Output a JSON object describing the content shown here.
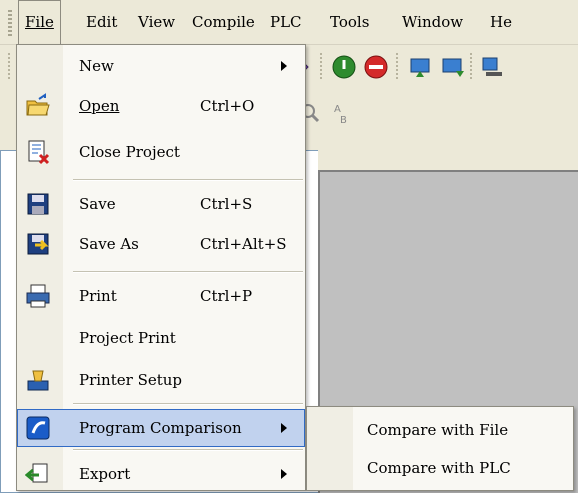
{
  "menubar": {
    "items": [
      {
        "label": "File"
      },
      {
        "label": "Edit"
      },
      {
        "label": "View"
      },
      {
        "label": "Compile"
      },
      {
        "label": "PLC"
      },
      {
        "label": "Tools"
      },
      {
        "label": "Window"
      },
      {
        "label": "He"
      }
    ]
  },
  "file_menu": {
    "items": [
      {
        "label": "New",
        "shortcut": "",
        "icon": "none",
        "has_submenu": true
      },
      {
        "label": "Open",
        "shortcut": "Ctrl+O",
        "icon": "open-folder-icon"
      },
      {
        "label": "Close Project",
        "shortcut": "",
        "icon": "close-project-icon"
      },
      {
        "label": "Save",
        "shortcut": "Ctrl+S",
        "icon": "save-disk-icon"
      },
      {
        "label": "Save As",
        "shortcut": "Ctrl+Alt+S",
        "icon": "save-as-icon"
      },
      {
        "label": "Print",
        "shortcut": "Ctrl+P",
        "icon": "printer-icon"
      },
      {
        "label": "Project Print",
        "shortcut": "",
        "icon": "none"
      },
      {
        "label": "Printer Setup",
        "shortcut": "",
        "icon": "printer-setup-icon"
      },
      {
        "label": "Program Comparison",
        "shortcut": "",
        "icon": "compare-icon",
        "has_submenu": true,
        "highlighted": true
      },
      {
        "label": "Export",
        "shortcut": "",
        "icon": "export-icon",
        "has_submenu": true
      }
    ]
  },
  "submenu": {
    "items": [
      {
        "label": "Compare with File"
      },
      {
        "label": "Compare with PLC"
      }
    ]
  },
  "colors": {
    "highlight_bg": "#c1d2ee",
    "highlight_border": "#316ac5",
    "menu_bg": "#f9f8f3",
    "workspace_bg": "#c0c0c0"
  }
}
